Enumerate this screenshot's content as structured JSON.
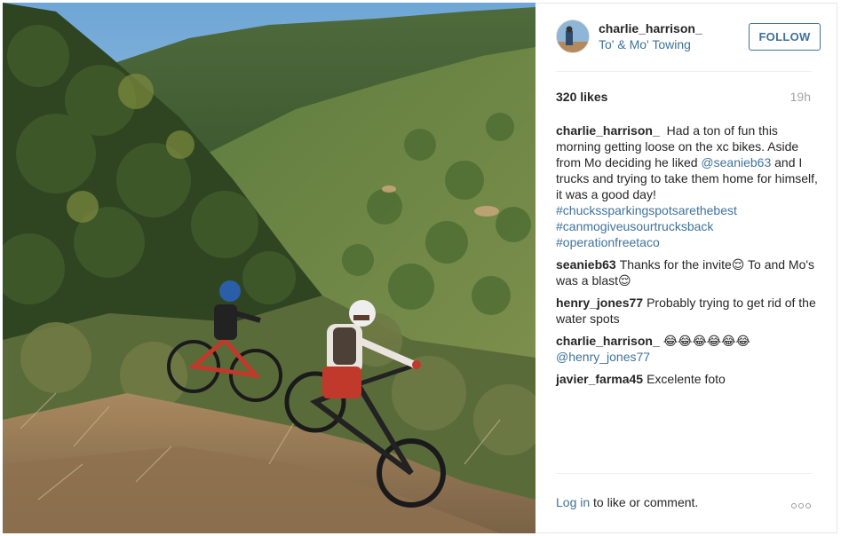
{
  "post": {
    "username": "charlie_harrison_",
    "location": "To' & Mo' Towing",
    "follow_label": "FOLLOW",
    "likes": "320 likes",
    "time": "19h"
  },
  "caption": {
    "user": "charlie_harrison_",
    "text1": "Had a ton of fun this morning getting loose on the xc bikes. Aside from Mo deciding he liked ",
    "mention": "@seanieb63",
    "text2": " and I trucks and trying to take them home for himself, it was a good day! ",
    "hashtags": [
      "#chuckssparkingspotsarethebest",
      "#canmogiveusourtrucksback",
      "#operationfreetaco"
    ]
  },
  "comments": [
    {
      "user": "seanieb63",
      "text": "Thanks for the invite😌 To and Mo's was a blast😌"
    },
    {
      "user": "henry_jones77",
      "text": "Probably trying to get rid of the water spots"
    },
    {
      "user": "charlie_harrison_",
      "text": "😂😂😂😂😂😂",
      "mention": "@henry_jones77"
    },
    {
      "user": "javier_farma45",
      "text": "Excelente foto"
    }
  ],
  "footer": {
    "login_label": "Log in",
    "rest": " to like or comment."
  },
  "icons": {
    "more": "more-options-icon",
    "avatar": "avatar"
  },
  "colors": {
    "link": "#3f729b",
    "text": "#262626",
    "muted": "#a5a5a5"
  }
}
